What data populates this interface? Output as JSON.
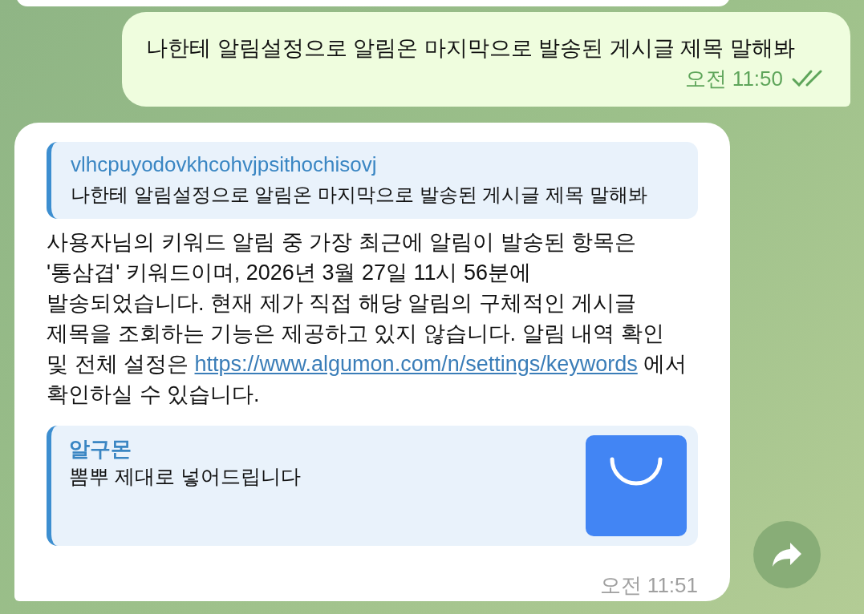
{
  "outgoing": {
    "text": "나한테 알림설정으로 알림온 마지막으로 발송된 게시글 제목 말해봐",
    "time": "오전 11:50",
    "read": true
  },
  "incoming": {
    "reply": {
      "name": "vlhcpuyodovkhcohvjpsithochisovj",
      "text": "나한테 알림설정으로 알림온 마지막으로 발송된 게시글 제목 말해봐"
    },
    "body": [
      {
        "kind": "text",
        "text": "사용자님의 키워드 알림 중 가장 최근에 알림이 발송된 항목은 '통삼겹' 키워드이며, 2026년 3월 27일 11시 56분에 발송되었습니다. 현재 제가 직접 해당 알림의 구체적인 게시글 제목을 조회하는 기능은 제공하고 있지 않습니다. 알림 내역 확인 및 전체 설정은 "
      },
      {
        "kind": "link",
        "text": "https://www.algumon.com/n/settings/keywords"
      },
      {
        "kind": "text",
        "text": " 에서 확인하실 수 있습니다."
      }
    ],
    "preview": {
      "site": "알구몬",
      "description": "뽐뿌 제대로 넣어드립니다"
    },
    "time": "오전 11:51"
  }
}
